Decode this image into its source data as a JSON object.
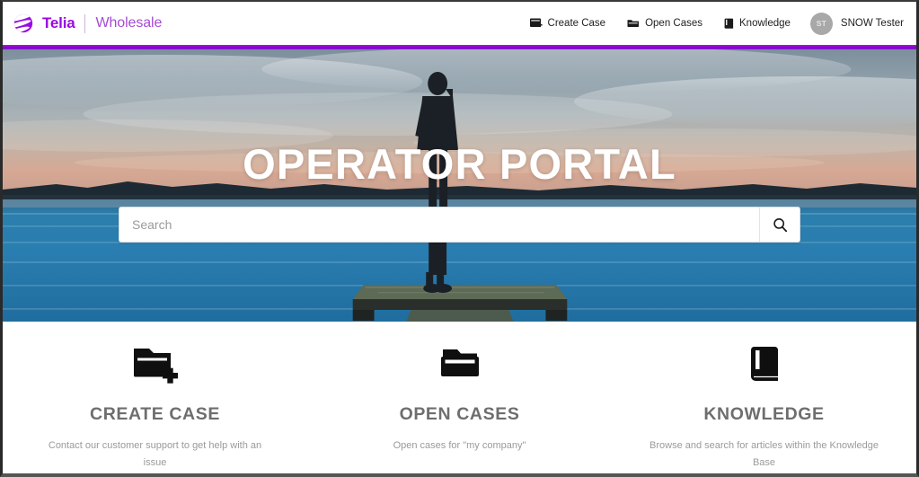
{
  "colors": {
    "brand_purple": "#990AE3",
    "brand_purple_light": "#A54BD6",
    "accent_bar": "#8E00CC",
    "card_title": "#6e6e6e",
    "card_desc": "#9a9a9a",
    "avatar_bg": "#a8a8a8"
  },
  "header": {
    "brand": {
      "logo_icon": "telia-swirl-logo",
      "name": "Telia",
      "sub": "Wholesale"
    },
    "nav": [
      {
        "icon": "create-case-icon",
        "label": "Create Case"
      },
      {
        "icon": "open-cases-folder-icon",
        "label": "Open Cases"
      },
      {
        "icon": "knowledge-book-icon",
        "label": "Knowledge"
      }
    ],
    "user": {
      "initials": "ST",
      "name": "SNOW Tester"
    }
  },
  "hero": {
    "title": "OPERATOR PORTAL",
    "image_alt": "Person standing on a wooden dock over blue water at dusk",
    "search": {
      "value": "",
      "placeholder": "Search",
      "button_icon": "search-magnifier-icon"
    }
  },
  "cards": [
    {
      "icon": "folder-plus-icon",
      "title": "CREATE CASE",
      "desc": "Contact our customer support to get help with an issue"
    },
    {
      "icon": "open-folder-icon",
      "title": "OPEN CASES",
      "desc": "Open cases for \"my company\""
    },
    {
      "icon": "book-icon",
      "title": "KNOWLEDGE",
      "desc": "Browse and search for articles within the Knowledge Base"
    }
  ]
}
